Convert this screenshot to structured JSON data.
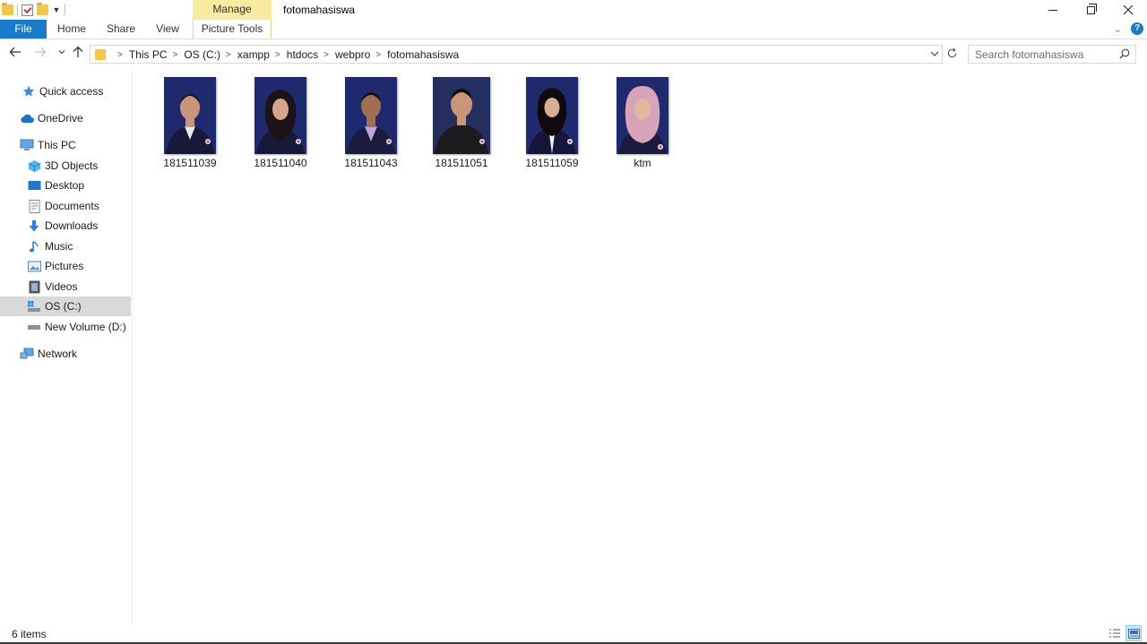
{
  "window": {
    "title": "fotomahasiswa",
    "contextual_group": "Manage"
  },
  "ribbon": {
    "tabs": [
      {
        "label": "File"
      },
      {
        "label": "Home"
      },
      {
        "label": "Share"
      },
      {
        "label": "View"
      },
      {
        "label": "Picture Tools"
      }
    ],
    "help": "?"
  },
  "address": {
    "breadcrumbs": [
      "This PC",
      "OS (C:)",
      "xampp",
      "htdocs",
      "webpro",
      "fotomahasiswa"
    ]
  },
  "search": {
    "placeholder": "Search fotomahasiswa",
    "value": ""
  },
  "navigation": {
    "quick_access": "Quick access",
    "onedrive": "OneDrive",
    "this_pc": "This PC",
    "items": [
      {
        "label": "3D Objects"
      },
      {
        "label": "Desktop"
      },
      {
        "label": "Documents"
      },
      {
        "label": "Downloads"
      },
      {
        "label": "Music"
      },
      {
        "label": "Pictures"
      },
      {
        "label": "Videos"
      },
      {
        "label": "OS (C:)",
        "selected": true
      },
      {
        "label": "New Volume (D:)"
      }
    ],
    "network": "Network"
  },
  "files": [
    {
      "name": "181511039",
      "icon": "photo-thumbnail"
    },
    {
      "name": "181511040",
      "icon": "photo-thumbnail"
    },
    {
      "name": "181511043",
      "icon": "photo-thumbnail"
    },
    {
      "name": "181511051",
      "icon": "photo-thumbnail"
    },
    {
      "name": "181511059",
      "icon": "photo-thumbnail"
    },
    {
      "name": "ktm",
      "icon": "photo-thumbnail"
    }
  ],
  "status": {
    "item_count": "6 items"
  },
  "colors": {
    "file_tab": "#1979ca",
    "manage_tab": "#f6eb9f",
    "selection": "#d9d9d9",
    "photo_background": "#1f2a6e"
  }
}
